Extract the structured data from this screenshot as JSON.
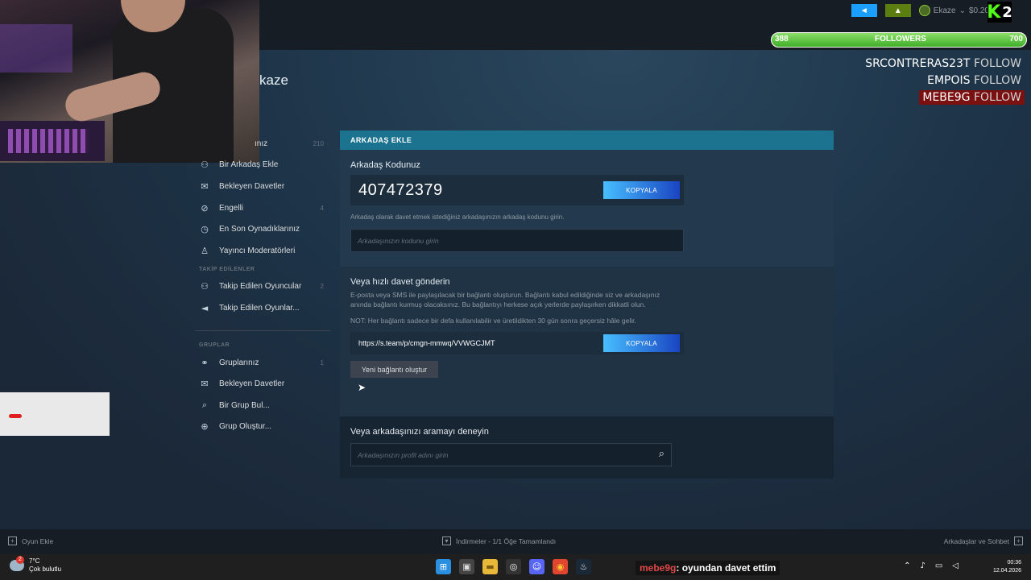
{
  "top_bar": {
    "announce_icon": "megaphone-icon",
    "notify_icon": "bell-icon",
    "user_name": "Ekaze",
    "wallet": "$0.20"
  },
  "overlay": {
    "kick_count": "2",
    "followers_current": "388",
    "followers_label": "FOLLOWERS",
    "followers_goal": "700",
    "followers_progress": 1.0,
    "follow_alerts": [
      {
        "user": "SRCONTRERAS23T",
        "action": "FOLLOW",
        "highlight": false
      },
      {
        "user": "EMPOIS",
        "action": "FOLLOW",
        "highlight": false
      },
      {
        "user": "MEBE9G",
        "action": "FOLLOW",
        "highlight": true
      }
    ]
  },
  "profile": {
    "name_partial": "kaze"
  },
  "sidebar": {
    "top_items": [
      {
        "label": "ınız",
        "count": "210",
        "icon": "friends-icon"
      },
      {
        "label": "Bir Arkadaş Ekle",
        "count": "",
        "icon": "add-friend-icon"
      },
      {
        "label": "Bekleyen Davetler",
        "count": "",
        "icon": "envelope-icon"
      },
      {
        "label": "Engelli",
        "count": "4",
        "icon": "blocked-icon"
      },
      {
        "label": "En Son Oynadıklarınız",
        "count": "",
        "icon": "clock-icon"
      },
      {
        "label": "Yayıncı Moderatörleri",
        "count": "",
        "icon": "user-icon"
      }
    ],
    "followed_header": "TAKİP EDİLENLER",
    "followed_items": [
      {
        "label": "Takip Edilen Oyuncular",
        "count": "2",
        "icon": "followed-players-icon"
      },
      {
        "label": "Takip Edilen Oyunlar...",
        "count": "",
        "icon": "megaphone-icon"
      }
    ],
    "groups_header": "GRUPLAR",
    "group_items": [
      {
        "label": "Gruplarınız",
        "count": "1",
        "icon": "group-icon"
      },
      {
        "label": "Bekleyen Davetler",
        "count": "",
        "icon": "envelope-icon"
      },
      {
        "label": "Bir Grup Bul...",
        "count": "",
        "icon": "search-icon"
      },
      {
        "label": "Grup Oluştur...",
        "count": "",
        "icon": "plus-circle-icon"
      }
    ]
  },
  "add_friend": {
    "header": "ARKADAŞ EKLE",
    "code_title": "Arkadaş Kodunuz",
    "code": "407472379",
    "copy_label": "KOPYALA",
    "code_hint": "Arkadaş olarak davet etmek istediğiniz arkadaşınızın arkadaş kodunu girin.",
    "code_placeholder": "Arkadaşınızın kodunu girin",
    "invite_title": "Veya hızlı davet gönderin",
    "invite_text": "E-posta veya SMS ile paylaşılacak bir bağlantı oluşturun. Bağlantı kabul edildiğinde siz ve arkadaşınız anında bağlantı kurmuş olacaksınız. Bu bağlantıyı herkese açık yerlerde paylaşırken dikkatli olun.",
    "invite_note": "NOT: Her bağlantı sadece bir defa kullanılabilir ve üretildikten 30 gün sonra geçersiz hâle gelir.",
    "invite_link": "https://s.team/p/cmgn-mmwq/VVWGCJMT",
    "copy_label_2": "KOPYALA",
    "new_link_label": "Yeni bağlantı oluştur",
    "search_title": "Veya arkadaşınızı aramayı deneyin",
    "search_placeholder": "Arkadaşınızın profil adını girin"
  },
  "steam_bottom": {
    "add_game": "Oyun Ekle",
    "downloads": "İndirmeler - 1/1 Öğe Tamamlandı",
    "friends_chat": "Arkadaşlar ve Sohbet"
  },
  "taskbar": {
    "temperature": "7°C",
    "weather": "Çok bulutlu",
    "weather_badge": "2",
    "chat_user": "mebe9g",
    "chat_text": ": oyundan davet ettim",
    "time": "00:36",
    "date": "12.04.2026"
  },
  "colors": {
    "accent_blue": "#1a9fff",
    "header_teal": "#1b738f",
    "kick_green": "#53fc18",
    "follow_highlight": "#7a1010"
  }
}
